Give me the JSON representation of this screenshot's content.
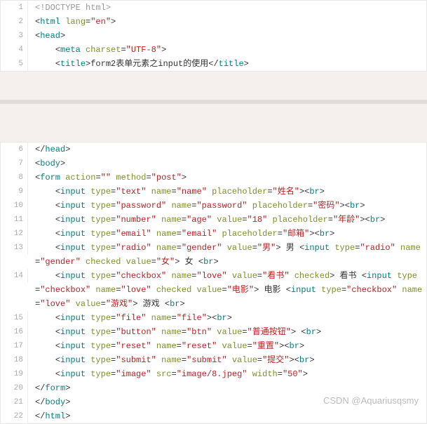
{
  "watermark": "CSDN @Aquariusqsmy",
  "block1": [
    {
      "n": "1",
      "html": "<span class='d'>&lt;!DOCTYPE html&gt;</span>"
    },
    {
      "n": "2",
      "html": "<span class='p'>&lt;</span><span class='t'>html </span><span class='a'>lang</span><span class='p'>=</span><span class='s'>\"en\"</span><span class='p'>&gt;</span>"
    },
    {
      "n": "3",
      "html": "<span class='p'>&lt;</span><span class='t'>head</span><span class='p'>&gt;</span>"
    },
    {
      "n": "4",
      "html": "    <span class='p'>&lt;</span><span class='t'>meta </span><span class='a'>charset</span><span class='p'>=</span><span class='s'>\"UTF-8\"</span><span class='p'>&gt;</span>"
    },
    {
      "n": "5",
      "html": "    <span class='p'>&lt;</span><span class='t'>title</span><span class='p'>&gt;</span>form2表单元素之input的使用<span class='p'>&lt;/</span><span class='t'>title</span><span class='p'>&gt;</span>"
    }
  ],
  "block2": [
    {
      "n": "6",
      "html": "<span class='p'>&lt;/</span><span class='t'>head</span><span class='p'>&gt;</span>"
    },
    {
      "n": "7",
      "html": "<span class='p'>&lt;</span><span class='t'>body</span><span class='p'>&gt;</span>"
    },
    {
      "n": "8",
      "html": "<span class='p'>&lt;</span><span class='t'>form </span><span class='a'>action</span><span class='p'>=</span><span class='s'>\"\"</span> <span class='a'>method</span><span class='p'>=</span><span class='s'>\"post\"</span><span class='p'>&gt;</span>"
    },
    {
      "n": "9",
      "html": "    <span class='p'>&lt;</span><span class='t'>input </span><span class='a'>type</span><span class='p'>=</span><span class='s'>\"text\"</span> <span class='a'>name</span><span class='p'>=</span><span class='s'>\"name\"</span> <span class='a'>placeholder</span><span class='p'>=</span><span class='s'>\"姓名\"</span><span class='p'>&gt;&lt;</span><span class='t'>br</span><span class='p'>&gt;</span>"
    },
    {
      "n": "10",
      "html": "    <span class='p'>&lt;</span><span class='t'>input </span><span class='a'>type</span><span class='p'>=</span><span class='s'>\"password\"</span> <span class='a'>name</span><span class='p'>=</span><span class='s'>\"password\"</span> <span class='a'>placeholder</span><span class='p'>=</span><span class='s'>\"密码\"</span><span class='p'>&gt;&lt;</span><span class='t'>br</span><span class='p'>&gt;</span>"
    },
    {
      "n": "11",
      "html": "    <span class='p'>&lt;</span><span class='t'>input </span><span class='a'>type</span><span class='p'>=</span><span class='s'>\"number\"</span> <span class='a'>name</span><span class='p'>=</span><span class='s'>\"age\"</span> <span class='a'>value</span><span class='p'>=</span><span class='s'>\"18\"</span> <span class='a'>placeholder</span><span class='p'>=</span><span class='s'>\"年龄\"</span><span class='p'>&gt;&lt;</span><span class='t'>br</span><span class='p'>&gt;</span>"
    },
    {
      "n": "12",
      "html": "    <span class='p'>&lt;</span><span class='t'>input </span><span class='a'>type</span><span class='p'>=</span><span class='s'>\"email\"</span> <span class='a'>name</span><span class='p'>=</span><span class='s'>\"email\"</span> <span class='a'>placeholder</span><span class='p'>=</span><span class='s'>\"邮箱\"</span><span class='p'>&gt;&lt;</span><span class='t'>br</span><span class='p'>&gt;</span>"
    },
    {
      "n": "13",
      "html": "    <span class='p'>&lt;</span><span class='t'>input </span><span class='a'>type</span><span class='p'>=</span><span class='s'>\"radio\"</span> <span class='a'>name</span><span class='p'>=</span><span class='s'>\"gender\"</span> <span class='a'>value</span><span class='p'>=</span><span class='s'>\"男\"</span><span class='p'>&gt;</span> 男 <span class='p'>&lt;</span><span class='t'>input </span><span class='a'>type</span><span class='p'>=</span><span class='s'>\"radio\"</span> <span class='a'>name</span><span class='p'>=</span><span class='s'>\"gender\"</span> <span class='a'>checked</span> <span class='a'>value</span><span class='p'>=</span><span class='s'>\"女\"</span><span class='p'>&gt;</span> 女 <span class='p'>&lt;</span><span class='t'>br</span><span class='p'>&gt;</span>"
    },
    {
      "n": "14",
      "html": "    <span class='p'>&lt;</span><span class='t'>input </span><span class='a'>type</span><span class='p'>=</span><span class='s'>\"checkbox\"</span> <span class='a'>name</span><span class='p'>=</span><span class='s'>\"love\"</span> <span class='a'>value</span><span class='p'>=</span><span class='s'>\"看书\"</span> <span class='a'>checked</span><span class='p'>&gt;</span> 看书 <span class='p'>&lt;</span><span class='t'>input </span><span class='a'>type</span><span class='p'>=</span><span class='s'>\"checkbox\"</span> <span class='a'>name</span><span class='p'>=</span><span class='s'>\"love\"</span> <span class='a'>checked</span> <span class='a'>value</span><span class='p'>=</span><span class='s'>\"电影\"</span><span class='p'>&gt;</span> 电影 <span class='p'>&lt;</span><span class='t'>input </span><span class='a'>type</span><span class='p'>=</span><span class='s'>\"checkbox\"</span> <span class='a'>name</span><span class='p'>=</span><span class='s'>\"love\"</span> <span class='a'>value</span><span class='p'>=</span><span class='s'>\"游戏\"</span><span class='p'>&gt;</span> 游戏 <span class='p'>&lt;</span><span class='t'>br</span><span class='p'>&gt;</span>"
    },
    {
      "n": "15",
      "html": "    <span class='p'>&lt;</span><span class='t'>input </span><span class='a'>type</span><span class='p'>=</span><span class='s'>\"file\"</span> <span class='a'>name</span><span class='p'>=</span><span class='s'>\"file\"</span><span class='p'>&gt;&lt;</span><span class='t'>br</span><span class='p'>&gt;</span>"
    },
    {
      "n": "16",
      "html": "    <span class='p'>&lt;</span><span class='t'>input </span><span class='a'>type</span><span class='p'>=</span><span class='s'>\"button\"</span> <span class='a'>name</span><span class='p'>=</span><span class='s'>\"btn\"</span> <span class='a'>value</span><span class='p'>=</span><span class='s'>\"普通按钮\"</span><span class='p'>&gt;</span> <span class='p'>&lt;</span><span class='t'>br</span><span class='p'>&gt;</span>"
    },
    {
      "n": "17",
      "html": "    <span class='p'>&lt;</span><span class='t'>input </span><span class='a'>type</span><span class='p'>=</span><span class='s'>\"reset\"</span> <span class='a'>name</span><span class='p'>=</span><span class='s'>\"reset\"</span> <span class='a'>value</span><span class='p'>=</span><span class='s'>\"重置\"</span><span class='p'>&gt;&lt;</span><span class='t'>br</span><span class='p'>&gt;</span>"
    },
    {
      "n": "18",
      "html": "    <span class='p'>&lt;</span><span class='t'>input </span><span class='a'>type</span><span class='p'>=</span><span class='s'>\"submit\"</span> <span class='a'>name</span><span class='p'>=</span><span class='s'>\"submit\"</span> <span class='a'>value</span><span class='p'>=</span><span class='s'>\"提交\"</span><span class='p'>&gt;&lt;</span><span class='t'>br</span><span class='p'>&gt;</span>"
    },
    {
      "n": "19",
      "html": "    <span class='p'>&lt;</span><span class='t'>input </span><span class='a'>type</span><span class='p'>=</span><span class='s'>\"image\"</span> <span class='a'>src</span><span class='p'>=</span><span class='s'>\"image/8.jpeg\"</span> <span class='a'>width</span><span class='p'>=</span><span class='s'>\"50\"</span><span class='p'>&gt;</span>"
    },
    {
      "n": "20",
      "html": "<span class='p'>&lt;/</span><span class='t'>form</span><span class='p'>&gt;</span>"
    },
    {
      "n": "21",
      "html": "<span class='p'>&lt;/</span><span class='t'>body</span><span class='p'>&gt;</span>"
    },
    {
      "n": "22",
      "html": "<span class='p'>&lt;/</span><span class='t'>html</span><span class='p'>&gt;</span>"
    }
  ]
}
